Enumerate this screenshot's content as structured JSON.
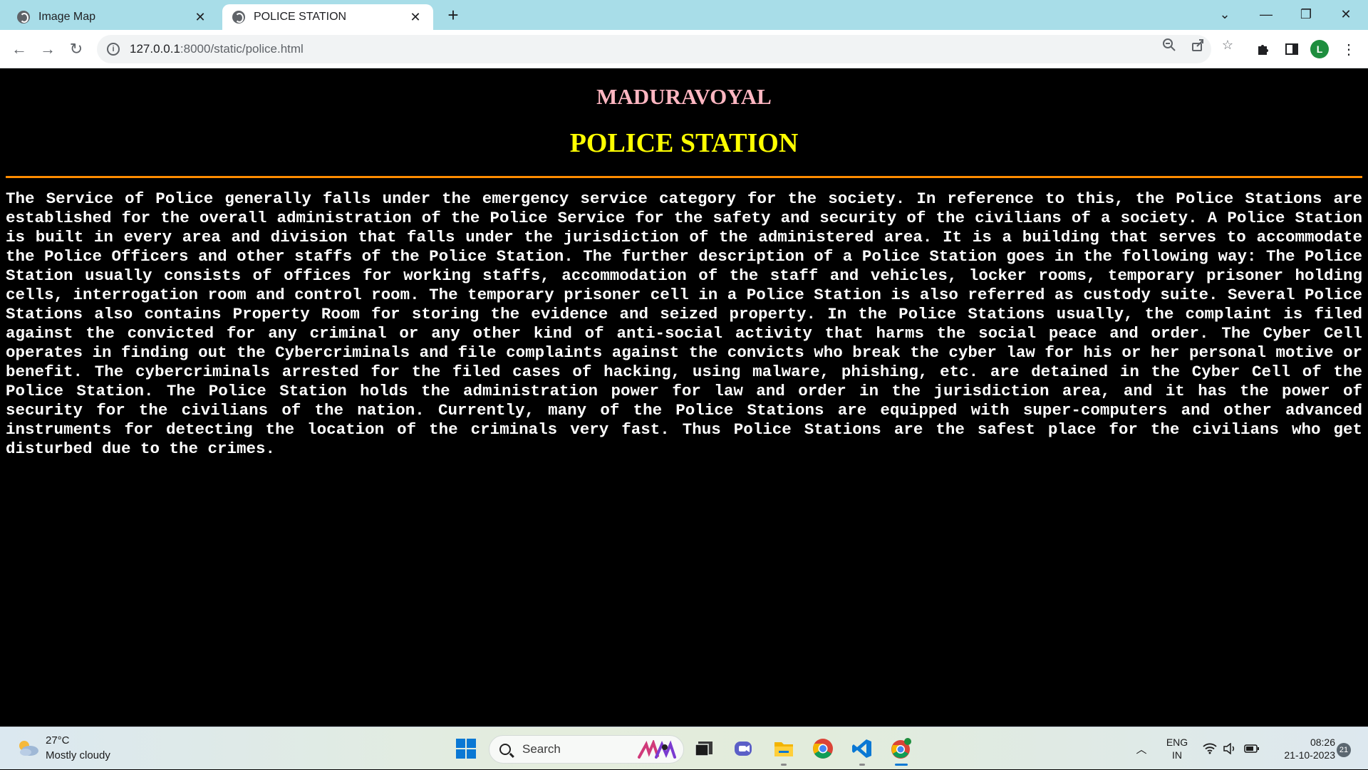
{
  "browser": {
    "tabs": [
      {
        "title": "Image Map",
        "active": false
      },
      {
        "title": "POLICE STATION",
        "active": true
      }
    ],
    "new_tab_label": "+",
    "window_controls": {
      "dropdown": "⌄",
      "minimize": "—",
      "maximize": "❐",
      "close": "✕"
    },
    "address": {
      "host": "127.0.0.1",
      "path": ":8000/static/police.html"
    },
    "profile_initial": "L"
  },
  "page": {
    "subtitle": "MADURAVOYAL",
    "title": "POLICE STATION",
    "paragraph": "The Service of Police generally falls under the emergency service category for the society. In reference to this, the Police Stations are established for the overall administration of the Police Service for the safety and security of the civilians of a society. A Police Station is built in every area and division that falls under the jurisdiction of the administered area. It is a building that serves to accommodate the Police Officers and other staffs of the Police Station. The further description of a Police Station goes in the following way: The Police Station usually consists of offices for working staffs, accommodation of the staff and vehicles, locker rooms, temporary prisoner holding cells, interrogation room and control room. The temporary prisoner cell in a Police Station is also referred as custody suite. Several Police Stations also contains Property Room for storing the evidence and seized property. In the Police Stations usually, the complaint is filed against the convicted for any criminal or any other kind of anti-social activity that harms the social peace and order. The Cyber Cell operates in finding out the Cybercriminals and file complaints against the convicts who break the cyber law for his or her personal motive or benefit. The cybercriminals arrested for the filed cases of hacking, using malware, phishing, etc. are detained in the Cyber Cell of the Police Station. The Police Station holds the administration power for law and order in the jurisdiction area, and it has the power of security for the civilians of the nation. Currently, many of the Police Stations are equipped with super-computers and other advanced instruments for detecting the location of the criminals very fast. Thus Police Stations are the safest place for the civilians who get disturbed due to the crimes."
  },
  "colors": {
    "subtitle": "#ffb6c1",
    "title": "#ffff00",
    "rule": "#ff8c00",
    "background": "#000000",
    "text": "#ffffff"
  },
  "taskbar": {
    "weather": {
      "temp": "27°C",
      "desc": "Mostly cloudy",
      "icon": "partly-cloudy-icon"
    },
    "search_placeholder": "Search",
    "pinned_icons": [
      "start-icon",
      "search-icon",
      "task-view-icon",
      "teams-chat-icon",
      "file-explorer-icon",
      "chrome-icon",
      "vscode-icon",
      "chrome-profile-icon"
    ],
    "language": {
      "line1": "ENG",
      "line2": "IN"
    },
    "clock": {
      "time": "08:26",
      "date": "21-10-2023"
    },
    "notifications": "21"
  }
}
